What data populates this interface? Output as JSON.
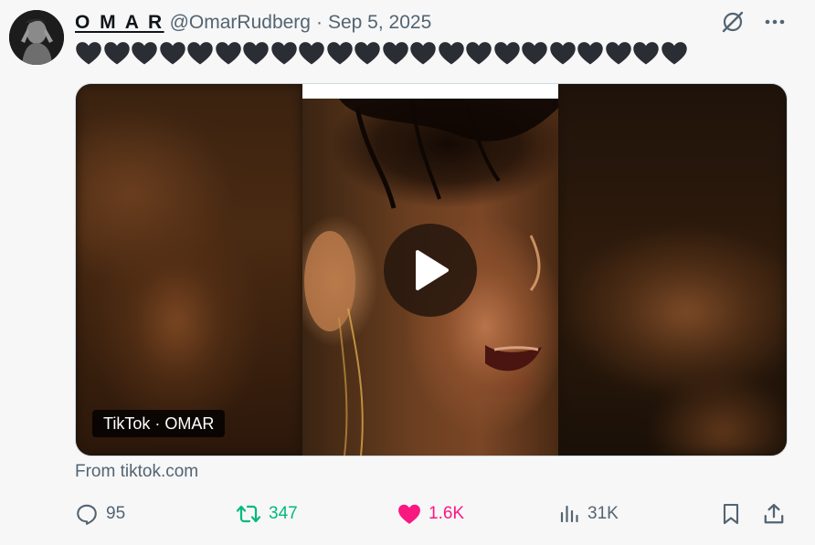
{
  "tweet": {
    "display_name": "O M A R",
    "handle": "@OmarRudberg",
    "separator": "·",
    "date": "Sep 5, 2025",
    "text_hearts_count": 22,
    "heart_emoji": "🖤",
    "avatar_icon": "avatar-photo"
  },
  "media": {
    "badge": "TikTok · OMAR",
    "from_label": "From tiktok.com",
    "play_icon": "play-icon"
  },
  "actions": {
    "replies": "95",
    "reposts": "347",
    "likes": "1.6K",
    "views": "31K"
  },
  "colors": {
    "repost": "#00ba7c",
    "like": "#f91880",
    "muted": "#536471",
    "heart_dark": "#2a2d33"
  }
}
